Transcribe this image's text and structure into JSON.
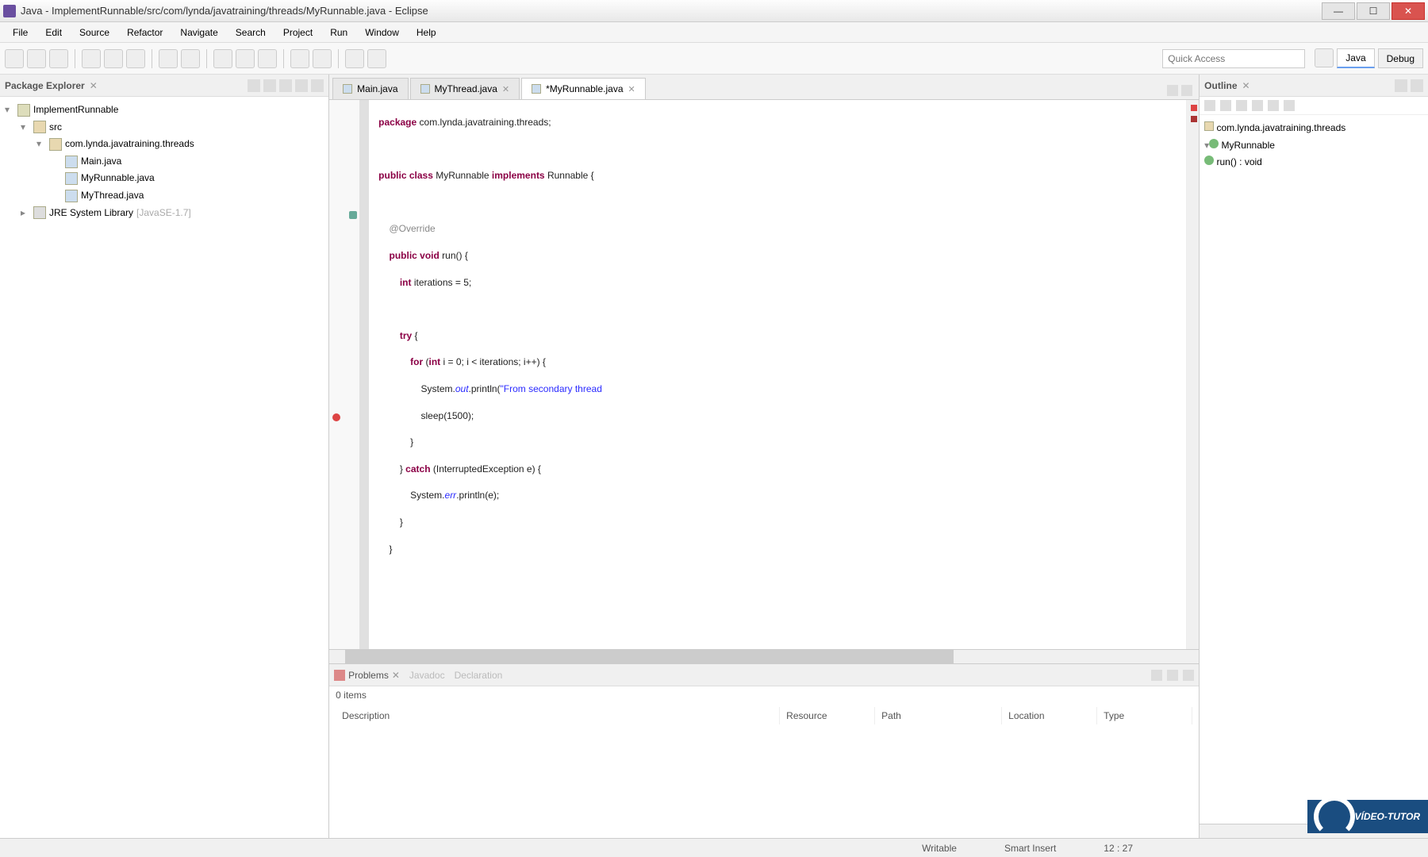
{
  "window": {
    "title": "Java - ImplementRunnable/src/com/lynda/javatraining/threads/MyRunnable.java - Eclipse"
  },
  "menu": [
    "File",
    "Edit",
    "Source",
    "Refactor",
    "Navigate",
    "Search",
    "Project",
    "Run",
    "Window",
    "Help"
  ],
  "quickAccess": {
    "placeholder": "Quick Access"
  },
  "perspectives": {
    "java": "Java",
    "debug": "Debug"
  },
  "packageExplorer": {
    "title": "Package Explorer",
    "project": "ImplementRunnable",
    "src": "src",
    "pkg": "com.lynda.javatraining.threads",
    "files": [
      "Main.java",
      "MyRunnable.java",
      "MyThread.java"
    ],
    "jre": "JRE System Library",
    "jreVer": "[JavaSE-1.7]"
  },
  "editorTabs": [
    {
      "label": "Main.java",
      "active": false
    },
    {
      "label": "MyThread.java",
      "active": false
    },
    {
      "label": "*MyRunnable.java",
      "active": true
    }
  ],
  "outline": {
    "title": "Outline",
    "pkg": "com.lynda.javatraining.threads",
    "cls": "MyRunnable",
    "method": "run() : void"
  },
  "problems": {
    "tab": "Problems",
    "tab2": "Javadoc",
    "tab3": "Declaration",
    "count": "0 items",
    "cols": [
      "Description",
      "Resource",
      "Path",
      "Location",
      "Type"
    ]
  },
  "status": {
    "writable": "Writable",
    "insert": "Smart Insert",
    "pos": "12 : 27"
  },
  "code": {
    "l1a": "package",
    "l1b": " com.lynda.javatraining.threads;",
    "l3a": "public",
    "l3b": " class",
    "l3c": " MyRunnable ",
    "l3d": "implements",
    "l3e": " Runnable {",
    "l5a": "    @Override",
    "l6a": "    public",
    "l6b": " void",
    "l6c": " run() {",
    "l7a": "        int",
    "l7b": " iterations = 5;",
    "l9a": "        try",
    "l9b": " {",
    "l10a": "            for",
    "l10b": " (",
    "l10c": "int",
    "l10d": " i = 0; i < iterations; i++) {",
    "l11a": "                System.",
    "l11b": "out",
    "l11c": ".println(",
    "l11d": "\"From secondary thread",
    "l12a": "                sleep(1500);",
    "l13a": "            }",
    "l14a": "        } ",
    "l14b": "catch",
    "l14c": " (InterruptedException e) {",
    "l15a": "            System.",
    "l15b": "err",
    "l15c": ".println(e);",
    "l16a": "        }",
    "l17a": "    }"
  },
  "watermark": "VÍDEO-TUTOR"
}
